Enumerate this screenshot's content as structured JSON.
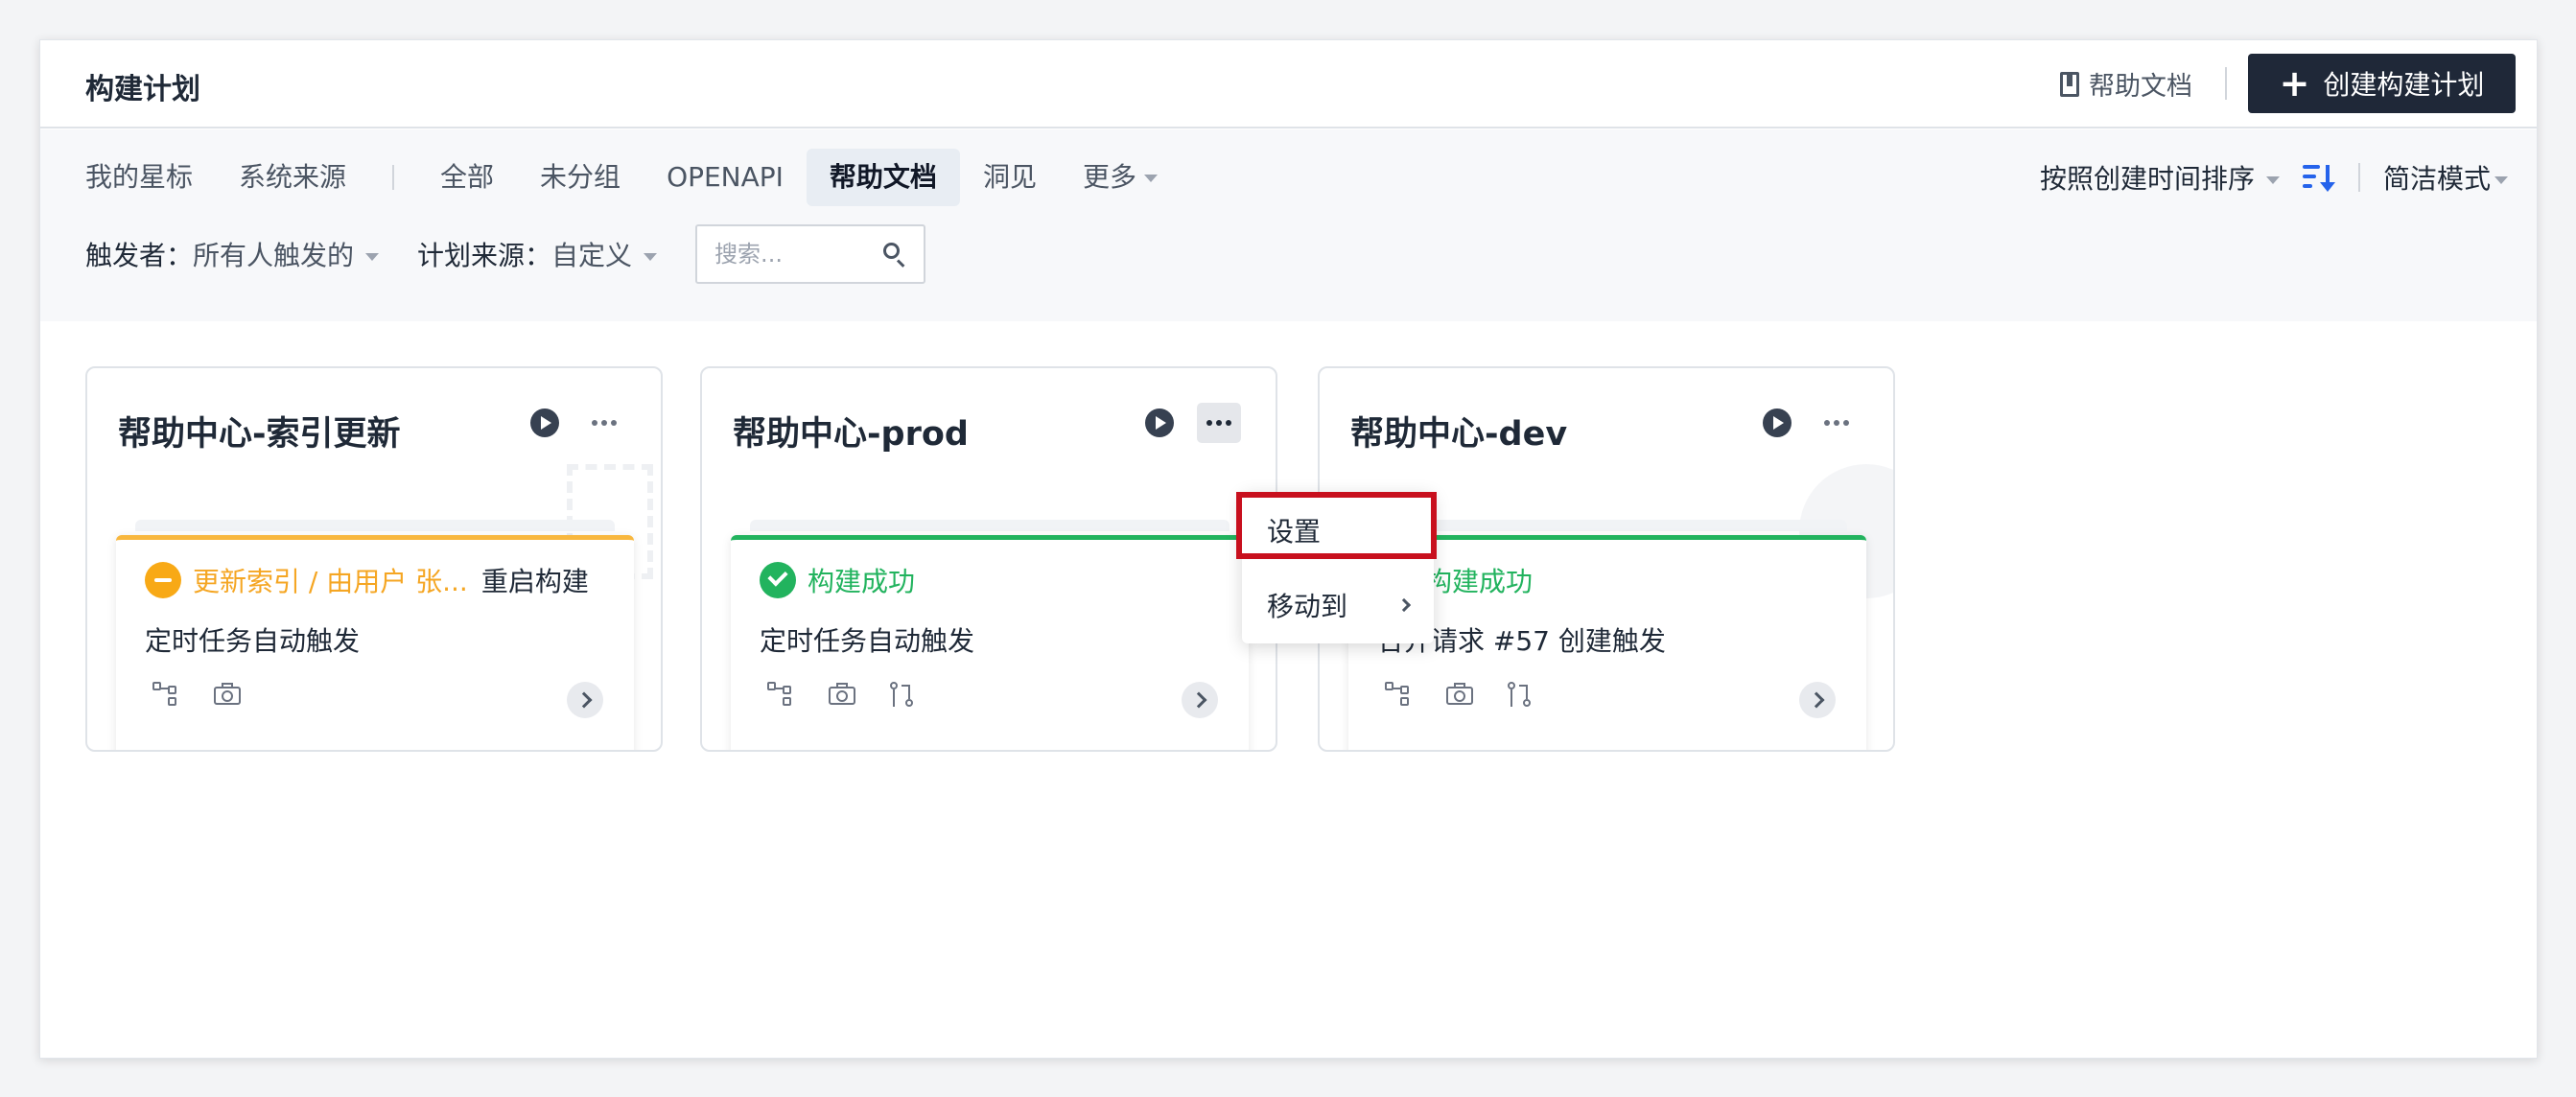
{
  "header": {
    "title": "构建计划",
    "help_label": "帮助文档",
    "create_label": "创建构建计划"
  },
  "tabs": {
    "items": [
      {
        "label": "我的星标"
      },
      {
        "label": "系统来源"
      },
      {
        "label": "全部"
      },
      {
        "label": "未分组"
      },
      {
        "label": "OPENAPI"
      },
      {
        "label": "帮助文档",
        "active": true
      },
      {
        "label": "洞见"
      },
      {
        "label": "更多"
      }
    ]
  },
  "sort": {
    "label": "按照创建时间排序",
    "mode_label": "简洁模式"
  },
  "filters": {
    "trigger_label": "触发者：",
    "trigger_value": "所有人触发的",
    "source_label": "计划来源：",
    "source_value": "自定义",
    "search_placeholder": "搜索..."
  },
  "cards": [
    {
      "title": "帮助中心-索引更新",
      "status": "更新索引 / 由用户 张...",
      "status_type": "warn",
      "restart_label": "重启构建",
      "trigger": "定时任务自动触发"
    },
    {
      "title": "帮助中心-prod",
      "status": "构建成功",
      "status_type": "ok",
      "trigger": "定时任务自动触发"
    },
    {
      "title": "帮助中心-dev",
      "status": "构建成功",
      "status_type": "ok",
      "trigger": "合并请求 #57 创建触发"
    }
  ],
  "menu": {
    "settings_label": "设置",
    "move_label": "移动到"
  },
  "colors": {
    "success": "#22b35e",
    "warning": "#f5a623",
    "primary_button": "#1f2838",
    "accent_blue": "#2563eb",
    "highlight": "#c8101e"
  }
}
